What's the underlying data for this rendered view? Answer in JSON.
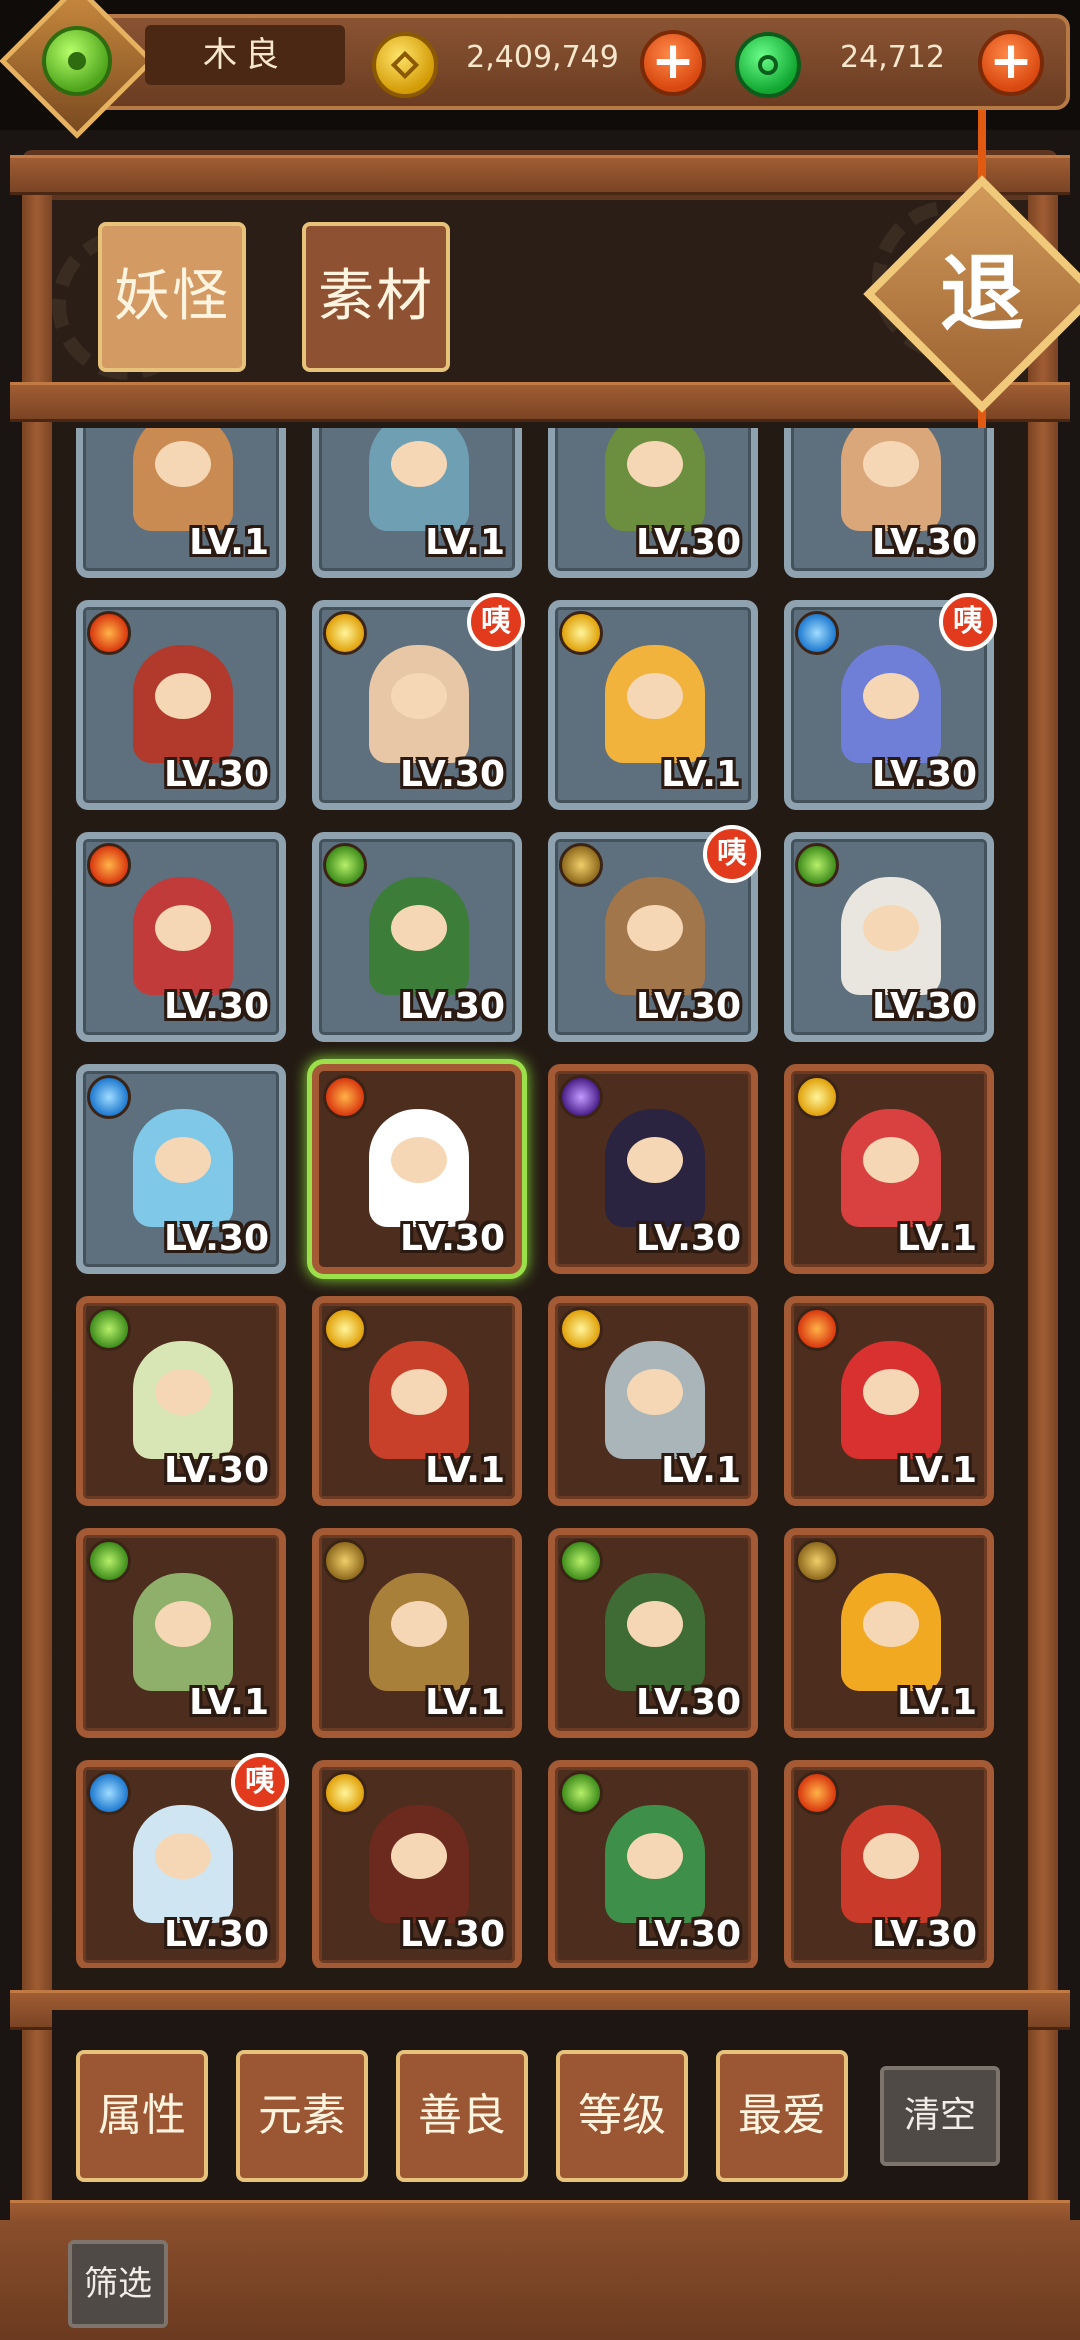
{
  "player": {
    "name": "木良",
    "gold": "2,409,749",
    "jade": "24,712",
    "plus_label": "+"
  },
  "tabs": [
    {
      "label": "妖怪",
      "active": true
    },
    {
      "label": "素材",
      "active": false
    }
  ],
  "exit_label": "退",
  "colors": {
    "frame_brown": "#5d3520",
    "card_gray": "#5e6f7d",
    "card_brown": "#4d2d1d",
    "selected_glow": "#9be04a",
    "badge_red": "#e23a1c"
  },
  "badge_label": "咦",
  "cards": [
    {
      "element": "none",
      "level": "LV.1",
      "style": "gray",
      "badge": false,
      "icon": "scholar-yokai-icon"
    },
    {
      "element": "none",
      "level": "LV.1",
      "style": "gray",
      "badge": false,
      "icon": "archer-yokai-icon"
    },
    {
      "element": "none",
      "level": "LV.30",
      "style": "gray",
      "badge": false,
      "icon": "rider-yokai-icon"
    },
    {
      "element": "none",
      "level": "LV.30",
      "style": "gray",
      "badge": false,
      "icon": "pig-yokai-icon"
    },
    {
      "element": "fire",
      "level": "LV.30",
      "style": "gray",
      "badge": false,
      "icon": "official-yokai-icon"
    },
    {
      "element": "light",
      "level": "LV.30",
      "style": "gray",
      "badge": true,
      "icon": "maiden-yokai-icon"
    },
    {
      "element": "light",
      "level": "LV.1",
      "style": "gray",
      "badge": false,
      "icon": "tofu-yokai-icon"
    },
    {
      "element": "water",
      "level": "LV.30",
      "style": "gray",
      "badge": true,
      "icon": "flower-yokai-icon"
    },
    {
      "element": "fire",
      "level": "LV.30",
      "style": "gray",
      "badge": false,
      "icon": "opera-yokai-icon"
    },
    {
      "element": "wood",
      "level": "LV.30",
      "style": "gray",
      "badge": false,
      "icon": "general-yokai-icon"
    },
    {
      "element": "earth",
      "level": "LV.30",
      "style": "gray",
      "badge": true,
      "icon": "puppet-yokai-icon"
    },
    {
      "element": "wood",
      "level": "LV.30",
      "style": "gray",
      "badge": false,
      "icon": "horse-yokai-icon"
    },
    {
      "element": "water",
      "level": "LV.30",
      "style": "gray",
      "badge": false,
      "icon": "ice-yokai-icon"
    },
    {
      "element": "fire",
      "level": "LV.30",
      "style": "brown",
      "badge": false,
      "icon": "card-yokai-icon",
      "selected": true
    },
    {
      "element": "dark",
      "level": "LV.30",
      "style": "brown",
      "badge": false,
      "icon": "princess-yokai-icon"
    },
    {
      "element": "light",
      "level": "LV.1",
      "style": "brown",
      "badge": false,
      "icon": "radish-yokai-icon"
    },
    {
      "element": "wood",
      "level": "LV.30",
      "style": "brown",
      "badge": false,
      "icon": "hermit-yokai-icon"
    },
    {
      "element": "light",
      "level": "LV.1",
      "style": "brown",
      "badge": false,
      "icon": "shrine-yokai-icon"
    },
    {
      "element": "light",
      "level": "LV.1",
      "style": "brown",
      "badge": false,
      "icon": "egg-yokai-icon"
    },
    {
      "element": "fire",
      "level": "LV.1",
      "style": "brown",
      "badge": false,
      "icon": "rose-yokai-icon"
    },
    {
      "element": "wood",
      "level": "LV.1",
      "style": "brown",
      "badge": false,
      "icon": "rice-yokai-icon"
    },
    {
      "element": "earth",
      "level": "LV.1",
      "style": "brown",
      "badge": false,
      "icon": "pot-yokai-icon"
    },
    {
      "element": "wood",
      "level": "LV.30",
      "style": "brown",
      "badge": false,
      "icon": "bamboo-yokai-icon"
    },
    {
      "element": "earth",
      "level": "LV.1",
      "style": "brown",
      "badge": false,
      "icon": "sunflower-yokai-icon"
    },
    {
      "element": "water",
      "level": "LV.30",
      "style": "brown",
      "badge": true,
      "icon": "igloo-yokai-icon"
    },
    {
      "element": "light",
      "level": "LV.30",
      "style": "brown",
      "badge": false,
      "icon": "pipa-yokai-icon"
    },
    {
      "element": "wood",
      "level": "LV.30",
      "style": "brown",
      "badge": false,
      "icon": "soldier-yokai-icon"
    },
    {
      "element": "fire",
      "level": "LV.30",
      "style": "brown",
      "badge": false,
      "icon": "cannon-yokai-icon"
    }
  ],
  "filters": [
    {
      "label": "属性"
    },
    {
      "label": "元素"
    },
    {
      "label": "善良"
    },
    {
      "label": "等级"
    },
    {
      "label": "最爱"
    }
  ],
  "clear_label": "清空",
  "screen_label": "筛选"
}
